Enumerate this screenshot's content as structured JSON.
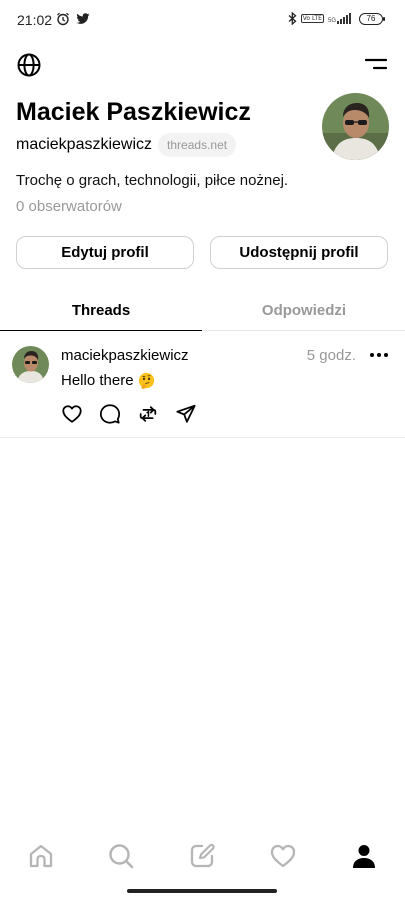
{
  "status_bar": {
    "time": "21:02",
    "icons": [
      "alarm-icon",
      "twitter-icon",
      "bluetooth-icon",
      "volte-icon",
      "5g-signal-icon"
    ],
    "volte_label": "Vo LTE",
    "net_label": "5G",
    "battery": "76"
  },
  "header": {
    "left_icon": "globe-icon",
    "right_icon": "menu-icon"
  },
  "profile": {
    "name": "Maciek Paszkiewicz",
    "handle": "maciekpaszkiewicz",
    "domain_pill": "threads.net",
    "bio": "Trochę o grach, technologii, piłce nożnej.",
    "followers": "0 obserwatorów",
    "edit_button": "Edytuj profil",
    "share_button": "Udostępnij profil"
  },
  "tabs": [
    {
      "label": "Threads",
      "active": true
    },
    {
      "label": "Odpowiedzi",
      "active": false
    }
  ],
  "posts": [
    {
      "username": "maciekpaszkiewicz",
      "time": "5 godz.",
      "text": "Hello there",
      "emoji": "thinking-face-emoji",
      "actions": [
        "heart-icon",
        "comment-icon",
        "repost-icon",
        "send-icon"
      ]
    }
  ],
  "bottom_nav": [
    "home-icon",
    "search-icon",
    "compose-icon",
    "heart-icon",
    "profile-icon"
  ],
  "colors": {
    "text_primary": "#000000",
    "text_secondary": "#999999",
    "border": "#d0d0d0",
    "pill_bg": "#f3f3f3",
    "inactive_icon": "#b5b5b5"
  }
}
